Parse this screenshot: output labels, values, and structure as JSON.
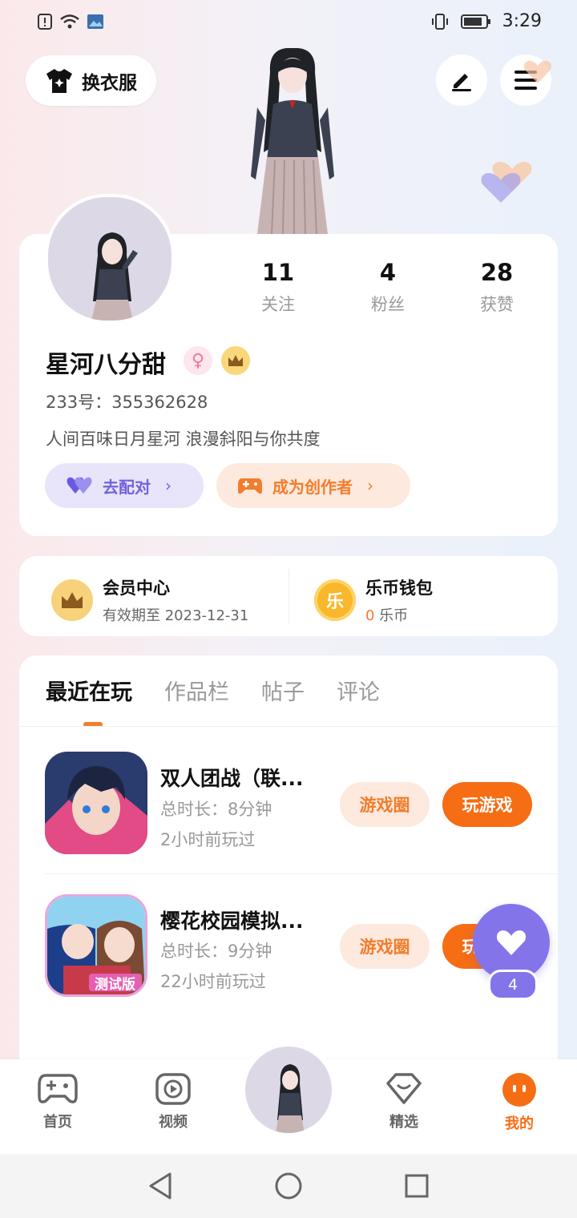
{
  "status_bar": {
    "time": "3:29"
  },
  "top": {
    "dress_label": "换衣服"
  },
  "profile": {
    "stats": [
      {
        "num": "11",
        "label": "关注"
      },
      {
        "num": "4",
        "label": "粉丝"
      },
      {
        "num": "28",
        "label": "获赞"
      }
    ],
    "name": "星河八分甜",
    "id_text": "233号：355362628",
    "bio": "人间百味日月星河 浪漫斜阳与你共度",
    "match_label": "去配对",
    "creator_label": "成为创作者"
  },
  "member": {
    "vip_title": "会员中心",
    "vip_sub": "有效期至 2023-12-31",
    "wallet_title": "乐币钱包",
    "wallet_amount": "0",
    "wallet_unit": " 乐币",
    "coin_char": "乐"
  },
  "tabs": [
    "最近在玩",
    "作品栏",
    "帖子",
    "评论"
  ],
  "games": [
    {
      "title": "双人团战（联...",
      "duration": "总时长：8分钟",
      "last_played": "2小时前玩过",
      "circle_label": "游戏圈",
      "play_label": "玩游戏"
    },
    {
      "title": "樱花校园模拟...",
      "duration": "总时长：9分钟",
      "last_played": "22小时前玩过",
      "circle_label": "游戏圈",
      "play_label": "玩游戏",
      "icon_tag": "测试版"
    }
  ],
  "like_fab": {
    "count": "4"
  },
  "bottom_nav": [
    {
      "label": "首页"
    },
    {
      "label": "视频"
    },
    {
      "label": "精选"
    },
    {
      "label": "我的"
    }
  ],
  "colors": {
    "accent": "#f66d13",
    "purple": "#8474ea"
  }
}
